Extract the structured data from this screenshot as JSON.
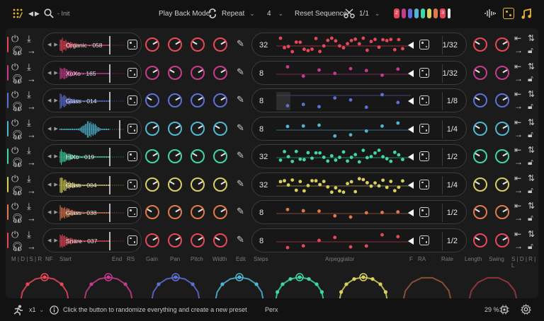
{
  "header": {
    "preset_name": "- Init",
    "playback_label": "Play Back Mode:",
    "playback_value": "Repeat",
    "playback_count": "4",
    "reset_label": "Reset Sequence:",
    "reset_value": "1/1",
    "swatch_numbers": [
      "2",
      "3"
    ],
    "swatch_colors": [
      "#e8475a",
      "#c73b8d",
      "#5f6fd6",
      "#4fb7d4",
      "#3fd7a3",
      "#d9d05a",
      "#e07a4d",
      "#e8475a",
      "#e8e8e8"
    ]
  },
  "tracks": [
    {
      "name": "Organic - 058",
      "color": "#e8475a",
      "steps": "32",
      "rate": "1/32",
      "dots": 32,
      "knobColor": "#e8475a"
    },
    {
      "name": "XoXo - 165",
      "color": "#c73b8d",
      "steps": "8",
      "rate": "1/32",
      "dots": 8,
      "knobColor": "#c73b8d"
    },
    {
      "name": "Glass - 014",
      "color": "#5f6fd6",
      "steps": "8",
      "rate": "1/8",
      "dots": 8,
      "knobColor": "#5f6fd6"
    },
    {
      "name": "",
      "color": "#4fb7d4",
      "steps": "8",
      "rate": "1/4",
      "dots": 8,
      "knobColor": "#4fb7d4"
    },
    {
      "name": "HiXo - 019",
      "color": "#3fd7a3",
      "steps": "32",
      "rate": "1/2",
      "dots": 32,
      "knobColor": "#3fd7a3"
    },
    {
      "name": "Glass - 004",
      "color": "#d9d05a",
      "steps": "32",
      "rate": "1/4",
      "dots": 32,
      "knobColor": "#d9d05a"
    },
    {
      "name": "Glass - 038",
      "color": "#e07a4d",
      "steps": "8",
      "rate": "1/2",
      "dots": 8,
      "knobColor": "#e07a4d"
    },
    {
      "name": "Snare - 037",
      "color": "#e8475a",
      "steps": "8",
      "rate": "1/2",
      "dots": 8,
      "knobColor": "#e8475a"
    }
  ],
  "columns": {
    "mdsr": "M | D | S | R",
    "nf": "NF",
    "start": "Start",
    "end": "End",
    "rs": "RS",
    "gain": "Gain",
    "pan": "Pan",
    "pitch": "Pitch",
    "width": "Width",
    "edit": "Edit",
    "steps": "Steps",
    "arpeggiator": "Arpeggiator",
    "f": "F",
    "ra": "RA",
    "rate": "Rate",
    "length": "Length",
    "swing": "Swing",
    "sdrl": "S | D | R | L"
  },
  "circle_colors": [
    "#e8475a",
    "#c73b8d",
    "#5f6fd6",
    "#4fb7d4",
    "#3fd7a3",
    "#d9d05a",
    "#e07a4d",
    "#e8475a"
  ],
  "status": {
    "multiplier": "x1",
    "hint": "Click the button to randomize everything and create a new preset",
    "kit": "Perx",
    "zoom": "29 %"
  }
}
